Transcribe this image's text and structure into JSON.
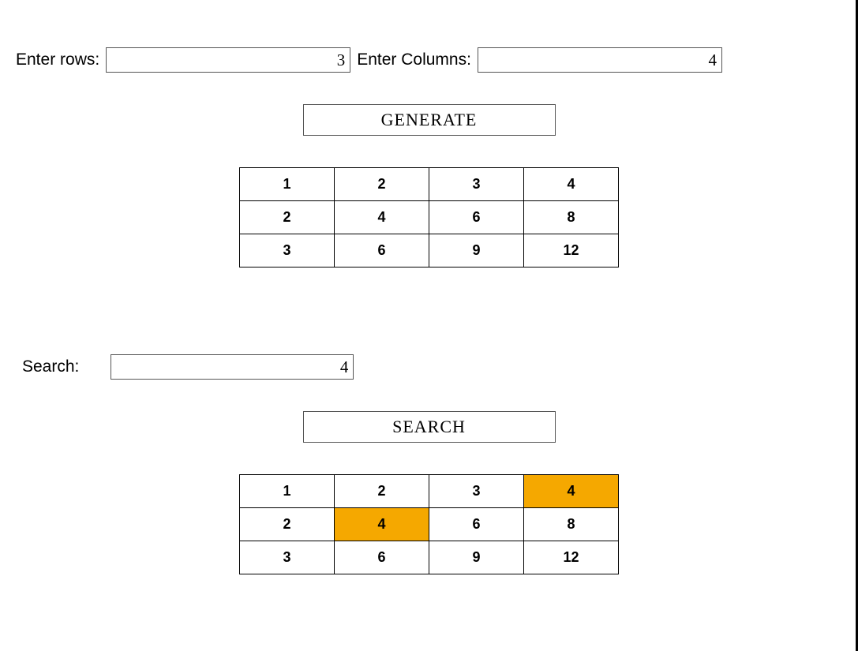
{
  "inputs": {
    "rows_label": "Enter rows:",
    "rows_value": "3",
    "cols_label": "Enter Columns:",
    "cols_value": "4",
    "search_label": "Search:",
    "search_value": "4"
  },
  "buttons": {
    "generate": "GENERATE",
    "search": "SEARCH"
  },
  "chart_data": [
    {
      "type": "table",
      "id": "multiplication-table-top",
      "rows": [
        [
          "1",
          "2",
          "3",
          "4"
        ],
        [
          "2",
          "4",
          "6",
          "8"
        ],
        [
          "3",
          "6",
          "9",
          "12"
        ]
      ],
      "highlights": []
    },
    {
      "type": "table",
      "id": "multiplication-table-bottom",
      "rows": [
        [
          "1",
          "2",
          "3",
          "4"
        ],
        [
          "2",
          "4",
          "6",
          "8"
        ],
        [
          "3",
          "6",
          "9",
          "12"
        ]
      ],
      "highlights": [
        [
          0,
          3
        ],
        [
          1,
          1
        ]
      ],
      "highlight_color": "#f5a800"
    }
  ]
}
